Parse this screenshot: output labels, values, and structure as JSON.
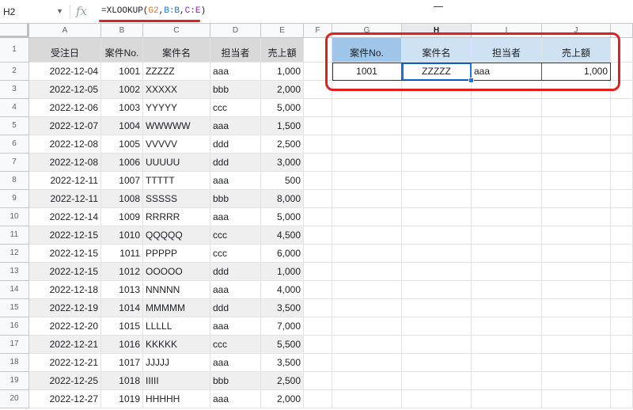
{
  "formula_bar": {
    "name_box": "H2",
    "fx_label": "fx",
    "formula_parts": [
      "=XLOOKUP(",
      "G2",
      ",",
      "B:B",
      ",",
      "C:E",
      ")"
    ]
  },
  "columns": [
    "A",
    "B",
    "C",
    "D",
    "E",
    "F",
    "G",
    "H",
    "I",
    "J"
  ],
  "rows": [
    "1",
    "2",
    "3",
    "4",
    "5",
    "6",
    "7",
    "8",
    "9",
    "10",
    "11",
    "12",
    "13",
    "14",
    "15",
    "16",
    "17",
    "18",
    "19",
    "20"
  ],
  "table": {
    "headers": [
      "受注日",
      "案件No.",
      "案件名",
      "担当者",
      "売上額"
    ],
    "rows": [
      [
        "2022-12-04",
        "1001",
        "ZZZZZ",
        "aaa",
        "1,000"
      ],
      [
        "2022-12-05",
        "1002",
        "XXXXX",
        "bbb",
        "2,000"
      ],
      [
        "2022-12-06",
        "1003",
        "YYYYY",
        "ccc",
        "5,000"
      ],
      [
        "2022-12-07",
        "1004",
        "WWWWW",
        "aaa",
        "1,500"
      ],
      [
        "2022-12-08",
        "1005",
        "VVVVV",
        "ddd",
        "2,500"
      ],
      [
        "2022-12-08",
        "1006",
        "UUUUU",
        "ddd",
        "3,000"
      ],
      [
        "2022-12-11",
        "1007",
        "TTTTT",
        "aaa",
        "500"
      ],
      [
        "2022-12-11",
        "1008",
        "SSSSS",
        "bbb",
        "8,000"
      ],
      [
        "2022-12-14",
        "1009",
        "RRRRR",
        "aaa",
        "5,000"
      ],
      [
        "2022-12-15",
        "1010",
        "QQQQQ",
        "ccc",
        "4,500"
      ],
      [
        "2022-12-15",
        "1011",
        "PPPPP",
        "ccc",
        "6,000"
      ],
      [
        "2022-12-15",
        "1012",
        "OOOOO",
        "ddd",
        "1,000"
      ],
      [
        "2022-12-18",
        "1013",
        "NNNNN",
        "aaa",
        "4,000"
      ],
      [
        "2022-12-19",
        "1014",
        "MMMMM",
        "ddd",
        "3,500"
      ],
      [
        "2022-12-20",
        "1015",
        "LLLLL",
        "aaa",
        "7,000"
      ],
      [
        "2022-12-21",
        "1016",
        "KKKKK",
        "ccc",
        "5,500"
      ],
      [
        "2022-12-21",
        "1017",
        "JJJJJ",
        "aaa",
        "3,500"
      ],
      [
        "2022-12-25",
        "1018",
        "IIIII",
        "bbb",
        "2,500"
      ],
      [
        "2022-12-27",
        "1019",
        "HHHHH",
        "aaa",
        "2,000"
      ]
    ]
  },
  "lookup": {
    "headers": [
      "案件No.",
      "案件名",
      "担当者",
      "売上額"
    ],
    "values": [
      "1001",
      "ZZZZZ",
      "aaa",
      "1,000"
    ]
  },
  "colors": {
    "accent": "#1a73e8",
    "highlight": "#e02020",
    "lookup_header": "#cfe2f3"
  }
}
